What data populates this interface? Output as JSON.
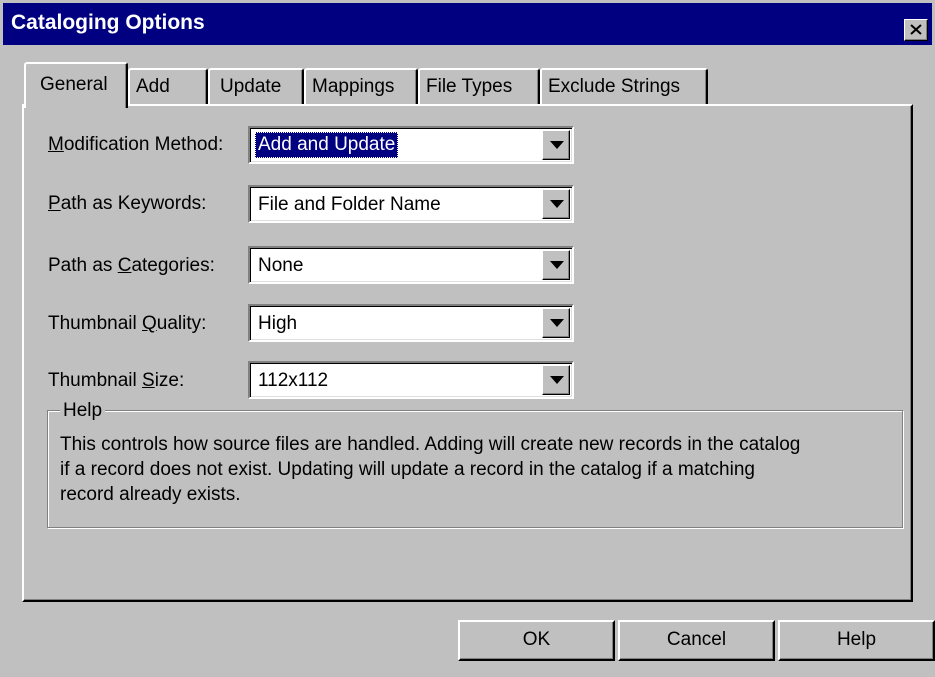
{
  "window": {
    "title": "Cataloging Options"
  },
  "tabs": [
    {
      "label": "General"
    },
    {
      "label": "Add"
    },
    {
      "label": "Update"
    },
    {
      "label": "Mappings"
    },
    {
      "label": "File Types"
    },
    {
      "label": "Exclude Strings"
    }
  ],
  "fields": {
    "modification_method": {
      "label_pre": "",
      "label_u": "M",
      "label_post": "odification Method:",
      "value": "Add and Update"
    },
    "path_keywords": {
      "label_pre": "",
      "label_u": "P",
      "label_post": "ath as Keywords:",
      "value": "File and Folder Name"
    },
    "path_categories": {
      "label_pre": "Path as ",
      "label_u": "C",
      "label_post": "ategories:",
      "value": "None"
    },
    "thumbnail_quality": {
      "label_pre": "Thumbnail ",
      "label_u": "Q",
      "label_post": "uality:",
      "value": "High"
    },
    "thumbnail_size": {
      "label_pre": "Thumbnail ",
      "label_u": "S",
      "label_post": "ize:",
      "value": "112x112"
    }
  },
  "help": {
    "title": "Help",
    "line1": "This controls how source files are handled. Adding will create new records in the catalog",
    "line2": "if a record does not exist. Updating will update a record in the catalog if a matching",
    "line3": "record already exists."
  },
  "buttons": {
    "ok": "OK",
    "cancel": "Cancel",
    "help": "Help"
  },
  "colors": {
    "titlebar": "#000080",
    "face": "#c0c0c0",
    "selection": "#000080"
  }
}
